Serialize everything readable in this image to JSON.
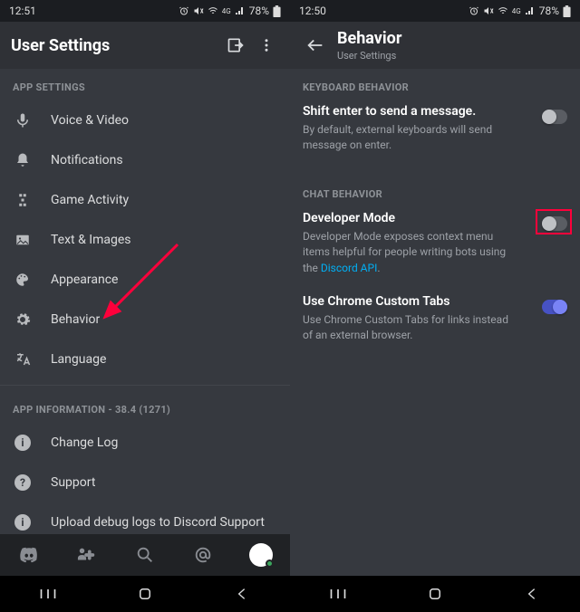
{
  "left": {
    "status": {
      "time": "12:51",
      "battery_pct": "78%"
    },
    "header": {
      "title": "User Settings"
    },
    "section_app_settings": "APP SETTINGS",
    "items_app": [
      {
        "icon": "voice-video",
        "label": "Voice & Video"
      },
      {
        "icon": "notifications",
        "label": "Notifications"
      },
      {
        "icon": "game-activity",
        "label": "Game Activity"
      },
      {
        "icon": "text-images",
        "label": "Text & Images"
      },
      {
        "icon": "appearance",
        "label": "Appearance"
      },
      {
        "icon": "behavior",
        "label": "Behavior"
      },
      {
        "icon": "language",
        "label": "Language"
      }
    ],
    "section_app_info": "APP INFORMATION - 38.4 (1271)",
    "items_info": [
      {
        "icon": "info",
        "label": "Change Log"
      },
      {
        "icon": "help",
        "label": "Support"
      },
      {
        "icon": "info",
        "label": "Upload debug logs to Discord Support"
      }
    ]
  },
  "right": {
    "status": {
      "time": "12:50",
      "battery_pct": "78%"
    },
    "header": {
      "title": "Behavior",
      "subtitle": "User Settings"
    },
    "section_keyboard": "KEYBOARD BEHAVIOR",
    "item_shift": {
      "title": "Shift enter to send a message.",
      "desc": "By default, external keyboards will send message on enter.",
      "on": false
    },
    "section_chat": "CHAT BEHAVIOR",
    "item_devmode": {
      "title": "Developer Mode",
      "desc_prefix": "Developer Mode exposes context menu items helpful for people writing bots using the ",
      "desc_link": "Discord API",
      "desc_suffix": ".",
      "on": false,
      "highlighted": true
    },
    "item_chrome": {
      "title": "Use Chrome Custom Tabs",
      "desc": "Use Chrome Custom Tabs for links instead of an external browser.",
      "on": true
    }
  },
  "icon_glyphs": {
    "alarm": "⏰",
    "mute": "🔇",
    "signal": "📶",
    "battery": "▮",
    "login": "↪",
    "overflow": "⋮",
    "back": "←"
  }
}
